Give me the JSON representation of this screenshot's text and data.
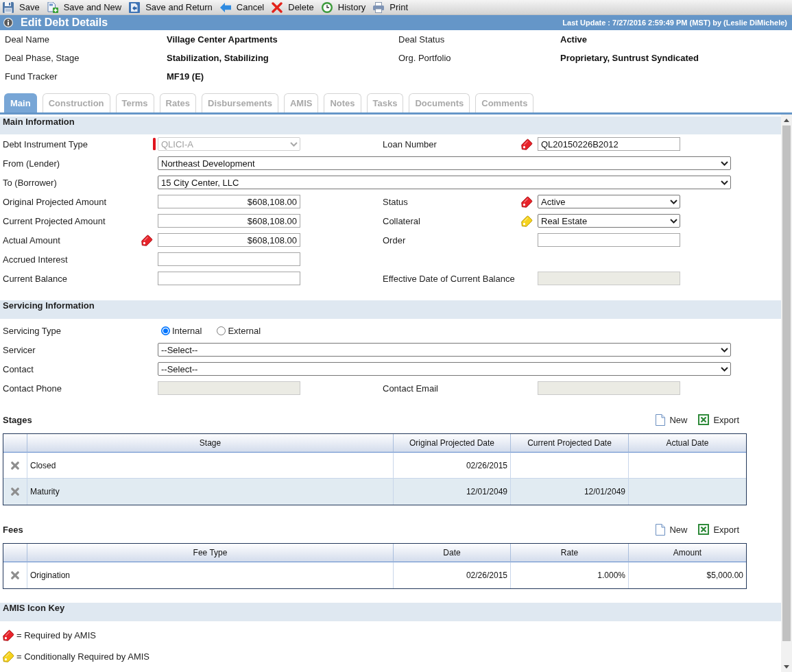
{
  "toolbar": [
    {
      "kind": "save",
      "label": "Save"
    },
    {
      "kind": "save_new",
      "label": "Save and New"
    },
    {
      "kind": "save_return",
      "label": "Save and Return"
    },
    {
      "kind": "cancel",
      "label": "Cancel"
    },
    {
      "kind": "delete",
      "label": "Delete"
    },
    {
      "kind": "history",
      "label": "History"
    },
    {
      "kind": "print",
      "label": "Print"
    }
  ],
  "title_bar": {
    "title": "Edit Debt Details",
    "last_update": "Last Update : 7/27/2016 2:59:49 PM (MST) by (Leslie DiMichele)"
  },
  "deal_info": [
    {
      "label": "Deal Name",
      "value": "Village Center Apartments"
    },
    {
      "label": "Deal Status",
      "value": "Active"
    },
    {
      "label": "Deal Phase, Stage",
      "value": "Stabilization, Stabilizing"
    },
    {
      "label": "Org. Portfolio",
      "value": "Proprietary, Suntrust Syndicated"
    },
    {
      "label": "Fund Tracker",
      "value": "MF19 (E)"
    }
  ],
  "tabs": [
    {
      "label": "Main",
      "selected": true
    },
    {
      "label": "Construction",
      "selected": false
    },
    {
      "label": "Terms",
      "selected": false
    },
    {
      "label": "Rates",
      "selected": false
    },
    {
      "label": "Disbursements",
      "selected": false
    },
    {
      "label": "AMIS",
      "selected": false
    },
    {
      "label": "Notes",
      "selected": false
    },
    {
      "label": "Tasks",
      "selected": false
    },
    {
      "label": "Documents",
      "selected": false
    },
    {
      "label": "Comments",
      "selected": false
    }
  ],
  "main_information": {
    "title": "Main Information",
    "rows": [
      [
        {
          "label": "Debt Instrument Type",
          "kind": "select",
          "value": "QLICI-A",
          "indicator": {
            "kind": "bar"
          },
          "disabled": true
        },
        {
          "label": "Loan Number",
          "kind": "text",
          "value": "QL20150226B2012",
          "indicator": {
            "kind": "required"
          },
          "disabled": false
        }
      ],
      [
        {
          "label": "From (Lender)",
          "kind": "select",
          "value": "Northeast Development",
          "disabled": false
        }
      ],
      [
        {
          "label": "To (Borrower)",
          "kind": "select",
          "value": "15 City Center, LLC",
          "disabled": false
        }
      ],
      [
        {
          "label": "Original Projected Amount",
          "kind": "amount",
          "value": "$608,108.00",
          "disabled": false
        },
        {
          "label": "Status",
          "kind": "select",
          "value": "Active",
          "indicator": {
            "kind": "required"
          },
          "disabled": false
        }
      ],
      [
        {
          "label": "Current Projected Amount",
          "kind": "amount",
          "value": "$608,108.00",
          "disabled": false
        },
        {
          "label": "Collateral",
          "kind": "select",
          "value": "Real Estate",
          "indicator": {
            "kind": "conditional"
          },
          "disabled": false
        }
      ],
      [
        {
          "label": "Actual Amount",
          "kind": "amount",
          "value": "$608,108.00",
          "indicator": {
            "kind": "required"
          },
          "disabled": false
        },
        {
          "label": "Order",
          "kind": "text",
          "disabled": false
        }
      ],
      [
        {
          "label": "Accrued Interest",
          "kind": "text",
          "disabled": false
        }
      ],
      [
        {
          "label": "Current Balance",
          "kind": "text",
          "disabled": false
        },
        {
          "label": "Effective Date of Current Balance",
          "kind": "text",
          "disabled": true
        }
      ]
    ]
  },
  "servicing_information": {
    "title": "Servicing Information",
    "rows": [
      [
        {
          "label": "Servicing Type",
          "kind": "radio",
          "options": [
            {
              "label": "Internal",
              "selected": true
            },
            {
              "label": "External",
              "selected": false
            }
          ]
        }
      ],
      [
        {
          "label": "Servicer",
          "kind": "select",
          "value": "--Select--",
          "disabled": false
        }
      ],
      [
        {
          "label": "Contact",
          "kind": "select",
          "value": "--Select--",
          "disabled": false
        }
      ],
      [
        {
          "label": "Contact Phone",
          "kind": "text",
          "disabled": true
        },
        {
          "label": "Contact Email",
          "kind": "text",
          "disabled": true
        }
      ]
    ]
  },
  "stages": {
    "title": "Stages",
    "actions": [
      {
        "kind": "new",
        "label": "New"
      },
      {
        "kind": "export",
        "label": "Export"
      }
    ],
    "columns": [
      "Stage",
      "Original Projected Date",
      "Current Projected Date",
      "Actual Date"
    ],
    "rows": [
      [
        "Closed",
        "02/26/2015",
        null,
        null
      ],
      [
        "Maturity",
        "12/01/2049",
        "12/01/2049",
        null
      ]
    ]
  },
  "fees": {
    "title": "Fees",
    "actions": [
      {
        "kind": "new",
        "label": "New"
      },
      {
        "kind": "export",
        "label": "Export"
      }
    ],
    "columns": [
      "Fee Type",
      "Date",
      "Rate",
      "Amount"
    ],
    "rows": [
      [
        "Origination",
        "02/26/2015",
        "1.000%",
        "$5,000.00"
      ]
    ]
  },
  "amis_icon_key": {
    "title": "AMIS Icon Key",
    "items": [
      {
        "kind": "required",
        "text": "= Required by AMIS"
      },
      {
        "kind": "conditional",
        "text": "= Conditionally Required by AMIS"
      }
    ]
  }
}
